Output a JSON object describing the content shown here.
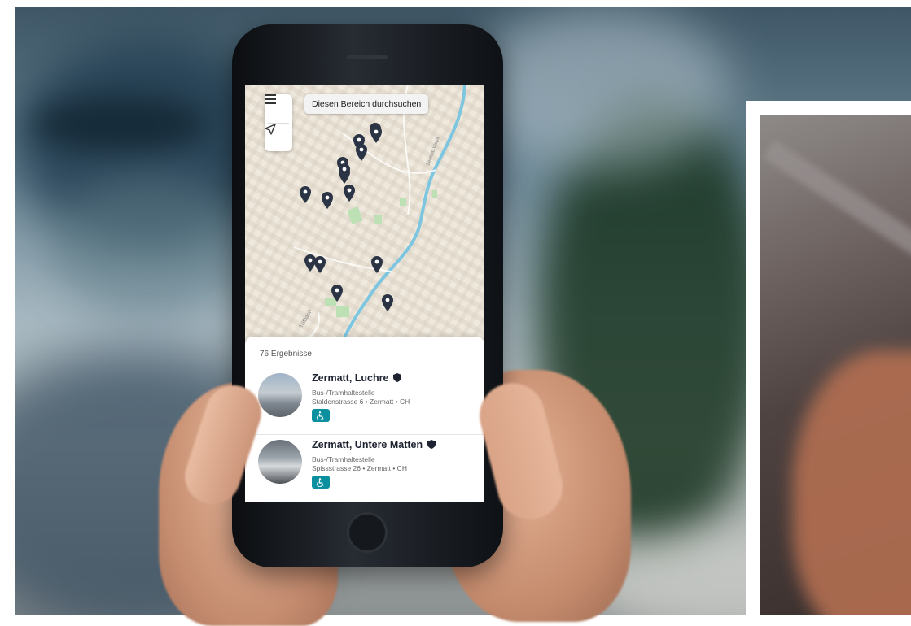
{
  "app": {
    "search_area_label": "Diesen Bereich durchsuchen",
    "menu_icon": "hamburger-menu-icon",
    "locate_icon": "navigation-arrow-icon",
    "map_pin_icon": "map-pin-icon",
    "map_pin_count_visible": 15,
    "street_labels": [
      "Trifbach",
      "Zermatt Vispa"
    ]
  },
  "results": {
    "count_label": "76 Ergebnisse",
    "items": [
      {
        "title": "Zermatt, Luchre",
        "type": "Bus-/Tramhaltestelle",
        "address": "Staldenstrasse 6 • Zermatt • CH",
        "badge_icon": "wheelchair-accessible-icon",
        "verified_icon": "shield-icon"
      },
      {
        "title": "Zermatt, Untere Matten",
        "type": "Bus-/Tramhaltestelle",
        "address": "Spissstrasse 26 • Zermatt • CH",
        "badge_icon": "wheelchair-accessible-icon",
        "verified_icon": "shield-icon"
      }
    ]
  },
  "colors": {
    "accent_teal": "#0c8f9e",
    "river_blue": "#7ec6e0",
    "pin_dark": "#2b3444",
    "map_bg": "#efe9dd"
  }
}
